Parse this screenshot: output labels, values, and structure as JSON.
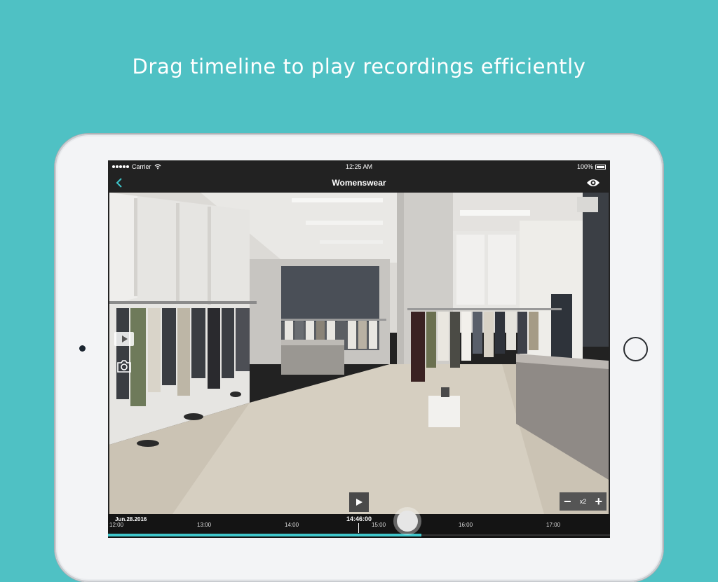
{
  "headline": "Drag timeline to play recordings efficiently",
  "status_bar": {
    "carrier": "Carrier",
    "time": "12:25 AM",
    "battery": "100%"
  },
  "nav": {
    "title": "Womenswear"
  },
  "timeline": {
    "date": "Jun.28.2016",
    "current_time": "14:46:00",
    "ticks": [
      "12:00",
      "13:00",
      "14:00",
      "15:00",
      "16:00",
      "17:00"
    ]
  },
  "zoom": {
    "minus": "−",
    "value": "x2",
    "plus": "+"
  },
  "colors": {
    "background": "#4fc1c4",
    "accent": "#3ec6cb"
  },
  "icons": {
    "back": "chevron-left-icon",
    "eye": "eye-icon",
    "play": "play-icon",
    "snapshot": "camera-icon"
  }
}
